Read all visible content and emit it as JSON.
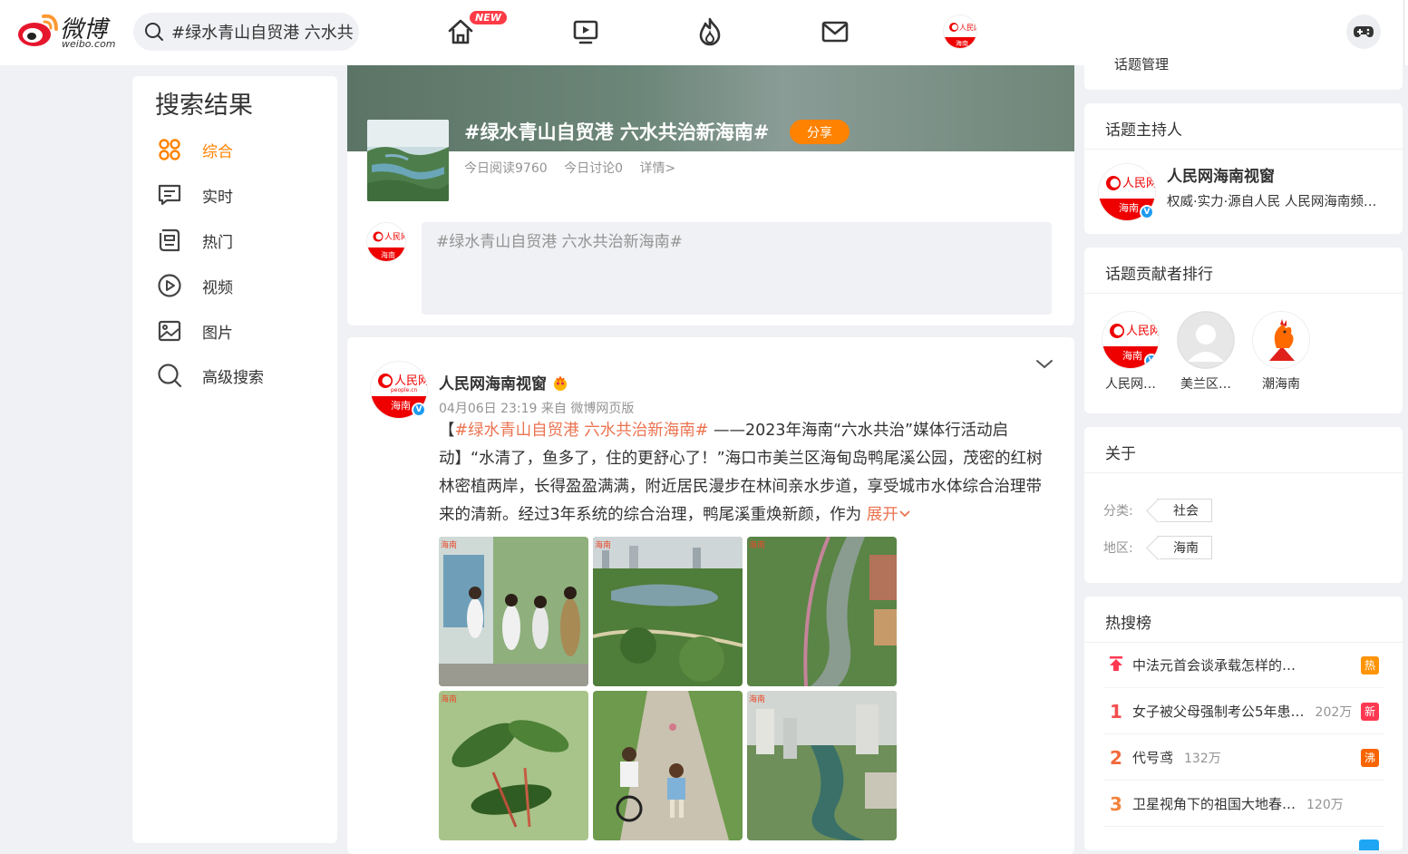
{
  "header": {
    "logo_cn": "微博",
    "logo_en": "weibo.com",
    "search_value": "#绿水青山自贸港 六水共治新海南#",
    "new_badge": "NEW",
    "nav_icons": [
      "home-icon",
      "video-icon",
      "hot-icon",
      "message-icon",
      "profile-avatar"
    ]
  },
  "left_nav": {
    "title": "搜索结果",
    "items": [
      {
        "label": "综合",
        "icon": "grid-icon",
        "active": true
      },
      {
        "label": "实时",
        "icon": "realtime-icon"
      },
      {
        "label": "热门",
        "icon": "hot-docs-icon"
      },
      {
        "label": "视频",
        "icon": "play-icon"
      },
      {
        "label": "图片",
        "icon": "image-icon"
      },
      {
        "label": "高级搜索",
        "icon": "search-icon"
      }
    ]
  },
  "topic": {
    "title": "#绿水青山自贸港 六水共治新海南#",
    "share_label": "分享",
    "reads": "今日阅读9760",
    "discussions": "今日讨论0",
    "details": "详情>",
    "composer_placeholder": "#绿水青山自贸港 六水共治新海南#"
  },
  "post": {
    "author": "人民网海南视窗",
    "meta": "04月06日 23:19  来自 微博网页版",
    "text_prefix": "【",
    "tag": "#绿水青山自贸港 六水共治新海南#",
    "text_body": " ——2023年海南“六水共治”媒体行活动启动】“水清了，鱼多了，住的更舒心了！”海口市美兰区海甸岛鸭尾溪公园，茂密的红树林密植两岸，长得盈盈满满，附近居民漫步在林间亲水步道，享受城市水体综合治理带来的清新。经过3年系统的综合治理，鸭尾溪重焕新颜，作为 ",
    "expand": "展开",
    "image_watermark": "海南"
  },
  "right": {
    "prev_card_tail": "话题管理",
    "host": {
      "title": "话题主持人",
      "name": "人民网海南视窗",
      "desc": "权威·实力·源自人民 人民网海南频道官方微博"
    },
    "contributors": {
      "title": "话题贡献者排行",
      "items": [
        "人民网…",
        "美兰区…",
        "潮海南"
      ]
    },
    "about": {
      "title": "关于",
      "category_label": "分类:",
      "category": "社会",
      "region_label": "地区:",
      "region": "海南"
    },
    "hot": {
      "title": "热搜榜",
      "rows": [
        {
          "rank": "",
          "title": "中法元首会谈承载怎样的期待",
          "count": "",
          "badge": "热",
          "badge_color": "#ff9406"
        },
        {
          "rank": "1",
          "title": "女子被父母强制考公5年患…",
          "count": "202万",
          "badge": "新",
          "badge_color": "#ff3852"
        },
        {
          "rank": "2",
          "title": "代号鸢",
          "count": "132万",
          "badge": "沸",
          "badge_color": "#f86400"
        },
        {
          "rank": "3",
          "title": "卫星视角下的祖国大地春…",
          "count": "120万",
          "badge": "",
          "badge_color": ""
        }
      ]
    }
  },
  "avatar_text": {
    "brand": "人民网",
    "domain": "people.cn",
    "region": "海南"
  }
}
